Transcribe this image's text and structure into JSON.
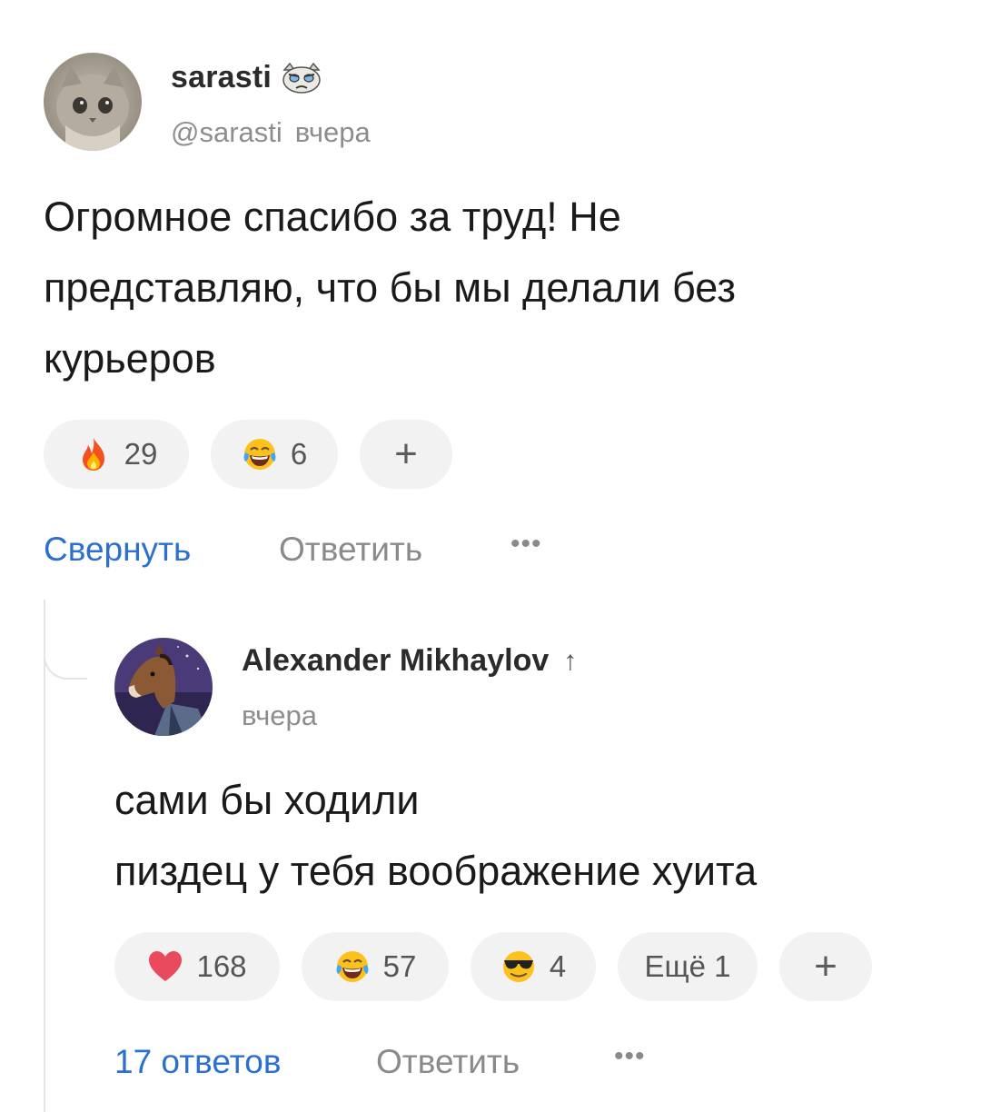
{
  "comment": {
    "author": {
      "name": "sarasti",
      "handle": "@sarasti",
      "badge_icon": "grumpy-cat-emoji"
    },
    "time": "вчера",
    "text_lines": [
      "Огромное спасибо за труд! Не",
      "представляю, что бы мы делали без",
      "курьеров"
    ],
    "reactions": [
      {
        "icon": "fire-emoji",
        "count": "29"
      },
      {
        "icon": "tears-of-joy-emoji",
        "count": "6"
      }
    ],
    "add_reaction": "+",
    "actions": {
      "collapse": "Свернуть",
      "reply": "Ответить",
      "more": "•••"
    }
  },
  "reply": {
    "author": {
      "name": "Alexander Mikhaylov",
      "badge": "↑"
    },
    "time": "вчера",
    "text_lines": [
      "сами бы ходили",
      "пиздец у тебя воображение хуита"
    ],
    "reactions": [
      {
        "icon": "red-heart-emoji",
        "count": "168"
      },
      {
        "icon": "tears-of-joy-emoji",
        "count": "57"
      },
      {
        "icon": "sunglasses-emoji",
        "count": "4"
      }
    ],
    "more_reactions": "Ещё 1",
    "add_reaction": "+",
    "actions": {
      "replies": "17 ответов",
      "reply": "Ответить",
      "more": "•••"
    }
  },
  "colors": {
    "link_blue": "#2b6fd1",
    "secondary_text": "#8d8d8d",
    "pill_bg": "#f2f2f3"
  }
}
